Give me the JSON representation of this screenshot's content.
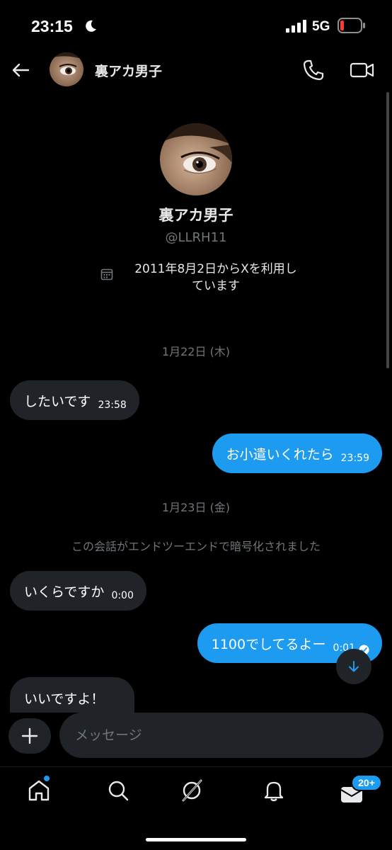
{
  "status_bar": {
    "time": "23:15",
    "network": "5G"
  },
  "header": {
    "name": "裏アカ男子"
  },
  "profile": {
    "name": "裏アカ男子",
    "handle": "@LLRH11",
    "joined_line1": "2011年8月2日からXを利用し",
    "joined_line2": "ています"
  },
  "messages": {
    "date1": "1月22日 (木)",
    "m1_text": "したいです",
    "m1_time": "23:58",
    "m2_text": "お小遣いくれたら",
    "m2_time": "23:59",
    "date2": "1月23日 (金)",
    "encryption_note": "この会話がエンドツーエンドで暗号化されました",
    "m3_text": "いくらですか",
    "m3_time": "0:00",
    "m4_text": "1100でしてるよー",
    "m4_time": "0:01",
    "m5_text": "いいですよ！"
  },
  "composer": {
    "placeholder": "メッセージ"
  },
  "nav": {
    "messages_badge": "20+"
  },
  "colors": {
    "accent": "#1d9bf0",
    "bubble_received": "#202327",
    "battery_low": "#ff3b30"
  },
  "icons": [
    "moon-icon",
    "signal-icon",
    "battery-icon",
    "back-arrow-icon",
    "phone-icon",
    "video-icon",
    "calendar-icon",
    "read-check-icon",
    "arrow-down-icon",
    "plus-icon",
    "home-icon",
    "search-icon",
    "grok-icon",
    "bell-icon",
    "envelope-icon"
  ]
}
